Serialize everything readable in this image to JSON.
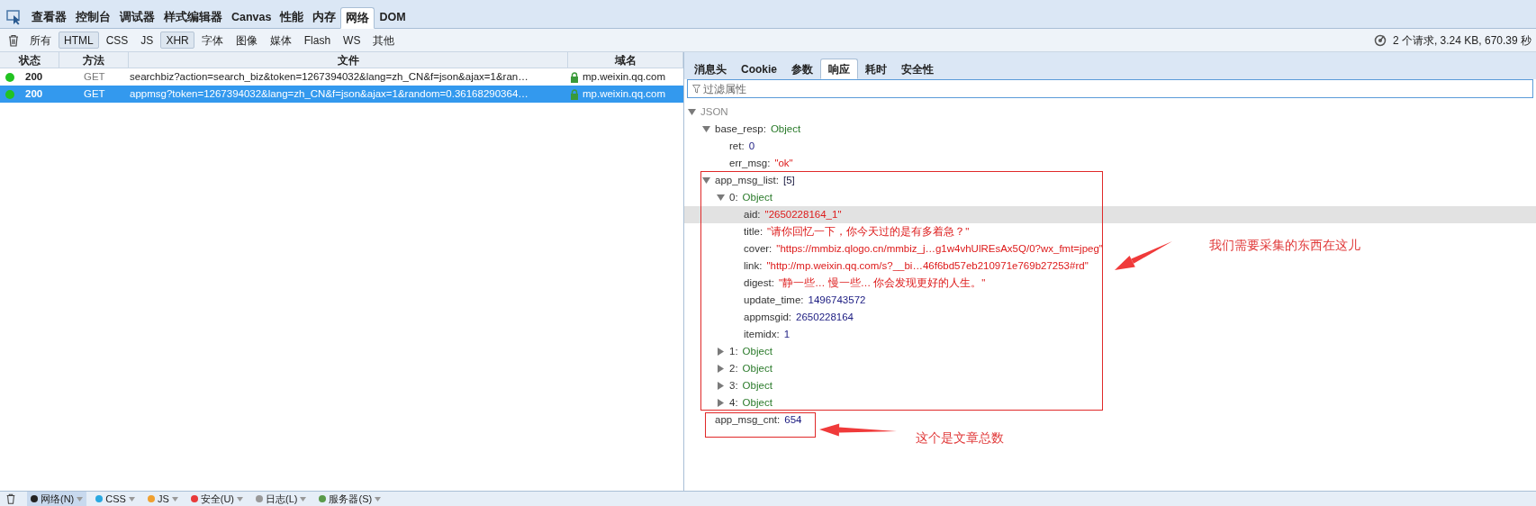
{
  "toolbox_tabs": [
    {
      "label": "查看器",
      "selected": false
    },
    {
      "label": "控制台",
      "selected": false
    },
    {
      "label": "调试器",
      "selected": false
    },
    {
      "label": "样式编辑器",
      "selected": false
    },
    {
      "label": "Canvas",
      "selected": false
    },
    {
      "label": "性能",
      "selected": false
    },
    {
      "label": "内存",
      "selected": false
    },
    {
      "label": "网络",
      "selected": true
    },
    {
      "label": "DOM",
      "selected": false
    }
  ],
  "filters": [
    {
      "label": "所有",
      "selected": false
    },
    {
      "label": "HTML",
      "selected": true
    },
    {
      "label": "CSS",
      "selected": false
    },
    {
      "label": "JS",
      "selected": false
    },
    {
      "label": "XHR",
      "selected": true
    },
    {
      "label": "字体",
      "selected": false
    },
    {
      "label": "图像",
      "selected": false
    },
    {
      "label": "媒体",
      "selected": false
    },
    {
      "label": "Flash",
      "selected": false
    },
    {
      "label": "WS",
      "selected": false
    },
    {
      "label": "其他",
      "selected": false
    }
  ],
  "summary": "2 个请求, 3.24 KB, 670.39 秒",
  "table": {
    "columns": [
      "状态",
      "方法",
      "文件",
      "域名"
    ],
    "rows": [
      {
        "status": "200",
        "method": "GET",
        "file": "searchbiz?action=search_biz&token=1267394032&lang=zh_CN&f=json&ajax=1&ran…",
        "domain": "mp.weixin.qq.com",
        "color": "#22c322",
        "secure": true,
        "selected": false
      },
      {
        "status": "200",
        "method": "GET",
        "file": "appmsg?token=1267394032&lang=zh_CN&f=json&ajax=1&random=0.36168290364…",
        "domain": "mp.weixin.qq.com",
        "color": "#22c322",
        "secure": true,
        "selected": true
      }
    ]
  },
  "detail_tabs": [
    {
      "label": "消息头",
      "selected": false
    },
    {
      "label": "Cookie",
      "selected": false
    },
    {
      "label": "参数",
      "selected": false
    },
    {
      "label": "响应",
      "selected": true
    },
    {
      "label": "耗时",
      "selected": false
    },
    {
      "label": "安全性",
      "selected": false
    }
  ],
  "filter_field": {
    "placeholder": "过滤属性"
  },
  "tree": [
    {
      "key": "JSON",
      "kind": "root",
      "expanded": true,
      "selected": false,
      "children": [
        {
          "key": "base_resp:",
          "value": "Object",
          "kind": "object",
          "expanded": true,
          "selected": false,
          "children": [
            {
              "key": "ret:",
              "value": "0",
              "kind": "number",
              "selected": false
            },
            {
              "key": "err_msg:",
              "value": "\"ok\"",
              "kind": "string",
              "selected": false
            }
          ]
        },
        {
          "key": "app_msg_list:",
          "value": "[5]",
          "kind": "array",
          "expanded": true,
          "selected": false,
          "children": [
            {
              "key": "0:",
              "value": "Object",
              "kind": "object",
              "expanded": true,
              "selected": false,
              "children": [
                {
                  "key": "aid:",
                  "value": "\"2650228164_1\"",
                  "kind": "string",
                  "selected": true
                },
                {
                  "key": "title:",
                  "value": "\"请你回忆一下，你今天过的是有多着急？\"",
                  "kind": "string",
                  "selected": false
                },
                {
                  "key": "cover:",
                  "value": "\"https://mmbiz.qlogo.cn/mmbiz_j…g1w4vhUlREsAx5Q/0?wx_fmt=jpeg\"",
                  "kind": "string",
                  "selected": false
                },
                {
                  "key": "link:",
                  "value": "\"http://mp.weixin.qq.com/s?__bi…46f6bd57eb210971e769b27253#rd\"",
                  "kind": "string",
                  "selected": false
                },
                {
                  "key": "digest:",
                  "value": "\"静一些… 慢一些… 你会发现更好的人生。\"",
                  "kind": "string",
                  "selected": false
                },
                {
                  "key": "update_time:",
                  "value": "1496743572",
                  "kind": "number",
                  "selected": false
                },
                {
                  "key": "appmsgid:",
                  "value": "2650228164",
                  "kind": "number",
                  "selected": false
                },
                {
                  "key": "itemidx:",
                  "value": "1",
                  "kind": "number",
                  "selected": false
                }
              ]
            },
            {
              "key": "1:",
              "value": "Object",
              "kind": "object",
              "expanded": false,
              "selected": false
            },
            {
              "key": "2:",
              "value": "Object",
              "kind": "object",
              "expanded": false,
              "selected": false
            },
            {
              "key": "3:",
              "value": "Object",
              "kind": "object",
              "expanded": false,
              "selected": false
            },
            {
              "key": "4:",
              "value": "Object",
              "kind": "object",
              "expanded": false,
              "selected": false
            }
          ]
        },
        {
          "key": "app_msg_cnt:",
          "value": "654",
          "kind": "number",
          "selected": false
        }
      ]
    }
  ],
  "annotations": [
    {
      "kind": "box"
    },
    {
      "kind": "arrow"
    },
    {
      "kind": "note",
      "text": "我们需要采集的东西在这儿"
    },
    {
      "kind": "box"
    },
    {
      "kind": "arrow"
    },
    {
      "kind": "note",
      "text": "这个是文章总数"
    }
  ],
  "bottom_bar": [
    {
      "label": "网络(N)",
      "color": "#222222",
      "selected": true
    },
    {
      "label": "CSS",
      "color": "#29a8e0",
      "selected": false
    },
    {
      "label": "JS",
      "color": "#f0a030",
      "selected": false
    },
    {
      "label": "安全(U)",
      "color": "#e83a3a",
      "selected": false
    },
    {
      "label": "日志(L)",
      "color": "#999999",
      "selected": false
    },
    {
      "label": "服务器(S)",
      "color": "#5a9a4a",
      "selected": false
    }
  ]
}
